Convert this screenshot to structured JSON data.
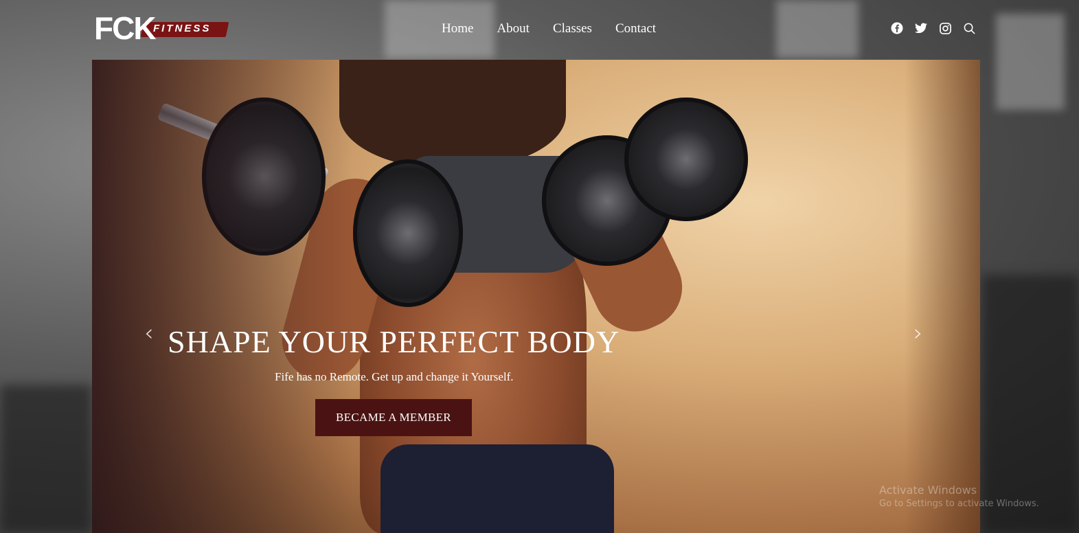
{
  "brand": {
    "logo_main": "FCK",
    "logo_sub": "FITNESS",
    "accent_color": "#7a1414"
  },
  "nav": {
    "items": [
      {
        "label": "Home"
      },
      {
        "label": "About"
      },
      {
        "label": "Classes"
      },
      {
        "label": "Contact"
      }
    ]
  },
  "social": {
    "icons": [
      "facebook-icon",
      "twitter-icon",
      "instagram-icon",
      "search-icon"
    ]
  },
  "hero": {
    "title": "SHAPE YOUR PERFECT BODY",
    "subtitle": "Fife has no Remote. Get up and change it Yourself.",
    "cta_label": "BECAME A MEMBER",
    "cta_color": "#4a1212",
    "prev_arrow": "‹",
    "next_arrow": "›"
  },
  "os_watermark": {
    "line1": "Activate Windows",
    "line2": "Go to Settings to activate Windows."
  }
}
